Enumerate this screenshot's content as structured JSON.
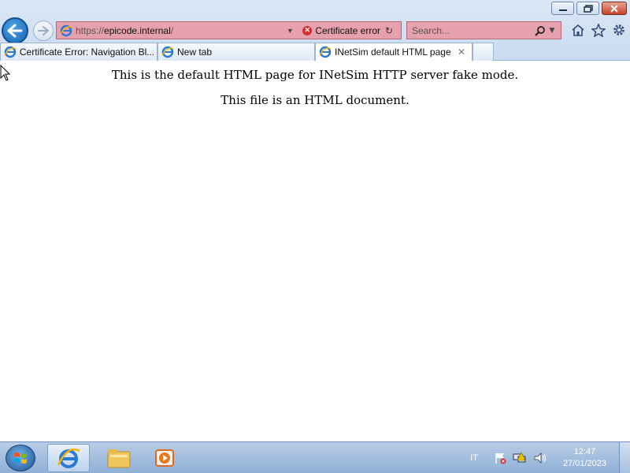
{
  "browser": {
    "url_prefix": "https://",
    "url_host": "epicode.internal",
    "url_suffix": "/",
    "certificate_error_label": "Certificate error",
    "search_placeholder": "Search...",
    "tabs": [
      {
        "title": "Certificate Error: Navigation Bl...",
        "active": false
      },
      {
        "title": "New tab",
        "active": false
      },
      {
        "title": "INetSim default HTML page",
        "active": true
      }
    ]
  },
  "page": {
    "line1": "This is the default HTML page for INetSim HTTP server fake mode.",
    "line2": "This file is an HTML document."
  },
  "taskbar": {
    "language": "IT",
    "time": "12:47",
    "date": "27/01/2023"
  },
  "colors": {
    "address_error": "#e7a0ad",
    "chrome_bg": "#c9daf0",
    "taskbar_bg": "#8fb0d6",
    "back_button": "#1663b3"
  },
  "icons": {
    "back": "back-arrow-icon",
    "forward": "forward-arrow-icon",
    "site": "ie-page-icon",
    "error": "certificate-error-icon",
    "refresh": "refresh-icon",
    "search": "search-icon",
    "home": "home-icon",
    "favorites": "star-icon",
    "tools": "gear-icon"
  }
}
